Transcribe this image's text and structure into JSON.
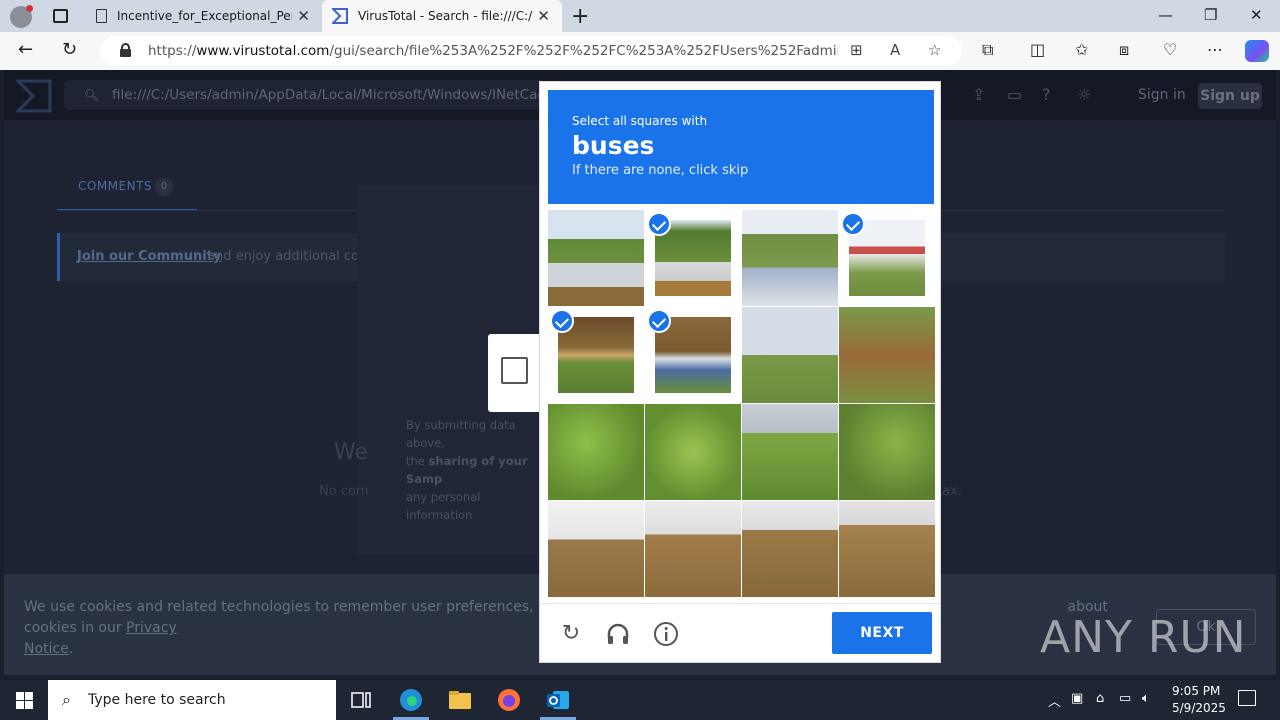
{
  "browser": {
    "tabs": [
      {
        "title": "Incentive_for_Exceptional_Perfor"
      },
      {
        "title": "VirusTotal - Search - file:///C:/Us"
      }
    ],
    "url_prefix": "https://",
    "url_host": "www.virustotal.com",
    "url_path": "/gui/search/file%253A%252F%252F%252FC%253A%252FUsers%252Fadmin%252F..."
  },
  "virustotal": {
    "search_value": "file:///C:/Users/admin/AppData/Local/Microsoft/Windows/INetCache/Co",
    "sign_in": "Sign in",
    "sign_up": "Sign up",
    "comments_label": "COMMENTS",
    "comments_count": "0",
    "community_link": "Join our Community",
    "community_text": "and enjoy additional com",
    "we_text": "We",
    "no_comments": "No com",
    "tax_text": "tax.",
    "submit_note_1": "By submitting data above,",
    "submit_note_2a": "the",
    "submit_note_2b": "sharing of your Samp",
    "submit_note_3": "any personal information",
    "cookie_text": "We use cookies and related technologies to remember user preferences, for security, to",
    "cookie_text_end": "about cookies in our",
    "cookie_link": "Privacy",
    "cookie_link_2": "Notice",
    "cookie_ok": "Ok"
  },
  "captcha": {
    "prompt": "Select all squares with",
    "target": "buses",
    "subtitle": "If there are none, click skip",
    "selected": [
      2,
      4,
      5,
      6
    ],
    "next_label": "NEXT"
  },
  "watermark": "ANY RUN",
  "taskbar": {
    "search_placeholder": "Type here to search",
    "time": "9:05 PM",
    "date": "5/9/2025"
  }
}
